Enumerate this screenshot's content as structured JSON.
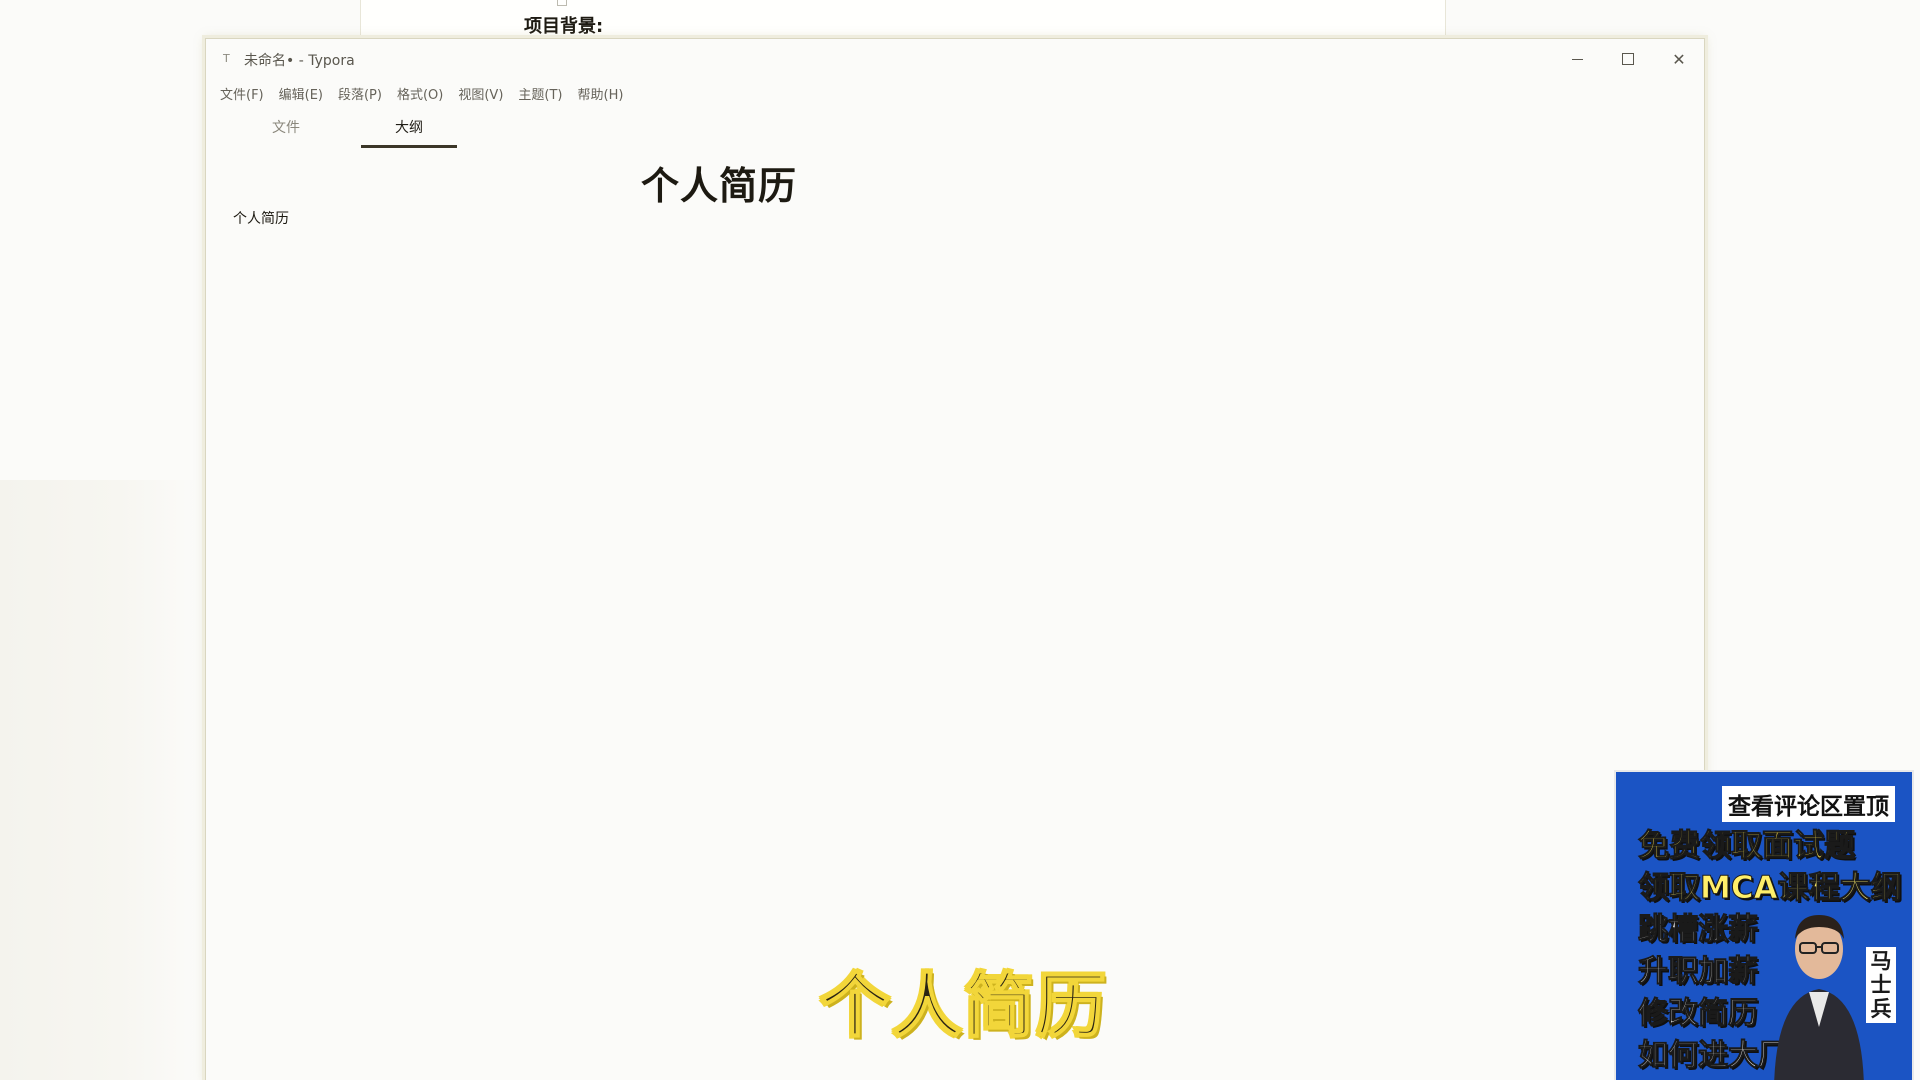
{
  "background_doc": {
    "heading": "项目背景:"
  },
  "window": {
    "title": "未命名• - Typora",
    "app_icon": "typora-icon",
    "controls": {
      "minimize": "minimize-icon",
      "maximize": "maximize-icon",
      "close": "✕"
    }
  },
  "menubar": {
    "items": [
      "文件(F)",
      "编辑(E)",
      "段落(P)",
      "格式(O)",
      "视图(V)",
      "主题(T)",
      "帮助(H)"
    ]
  },
  "sidebar": {
    "tabs": [
      {
        "label": "文件",
        "active": false
      },
      {
        "label": "大纲",
        "active": true
      }
    ],
    "outline": [
      "个人简历"
    ]
  },
  "editor": {
    "heading1": "个人简历"
  },
  "caption": "个人简历",
  "ad": {
    "banner": "查看评论区置顶",
    "lines": [
      "免费领取面试题",
      "领取MCA课程大纲",
      "跳槽涨薪",
      "升职加薪",
      "修改简历",
      "如何进大厂"
    ],
    "brand": "马士兵",
    "colors": {
      "background": "#1b54c4",
      "highlight": "#ffe34a"
    }
  }
}
